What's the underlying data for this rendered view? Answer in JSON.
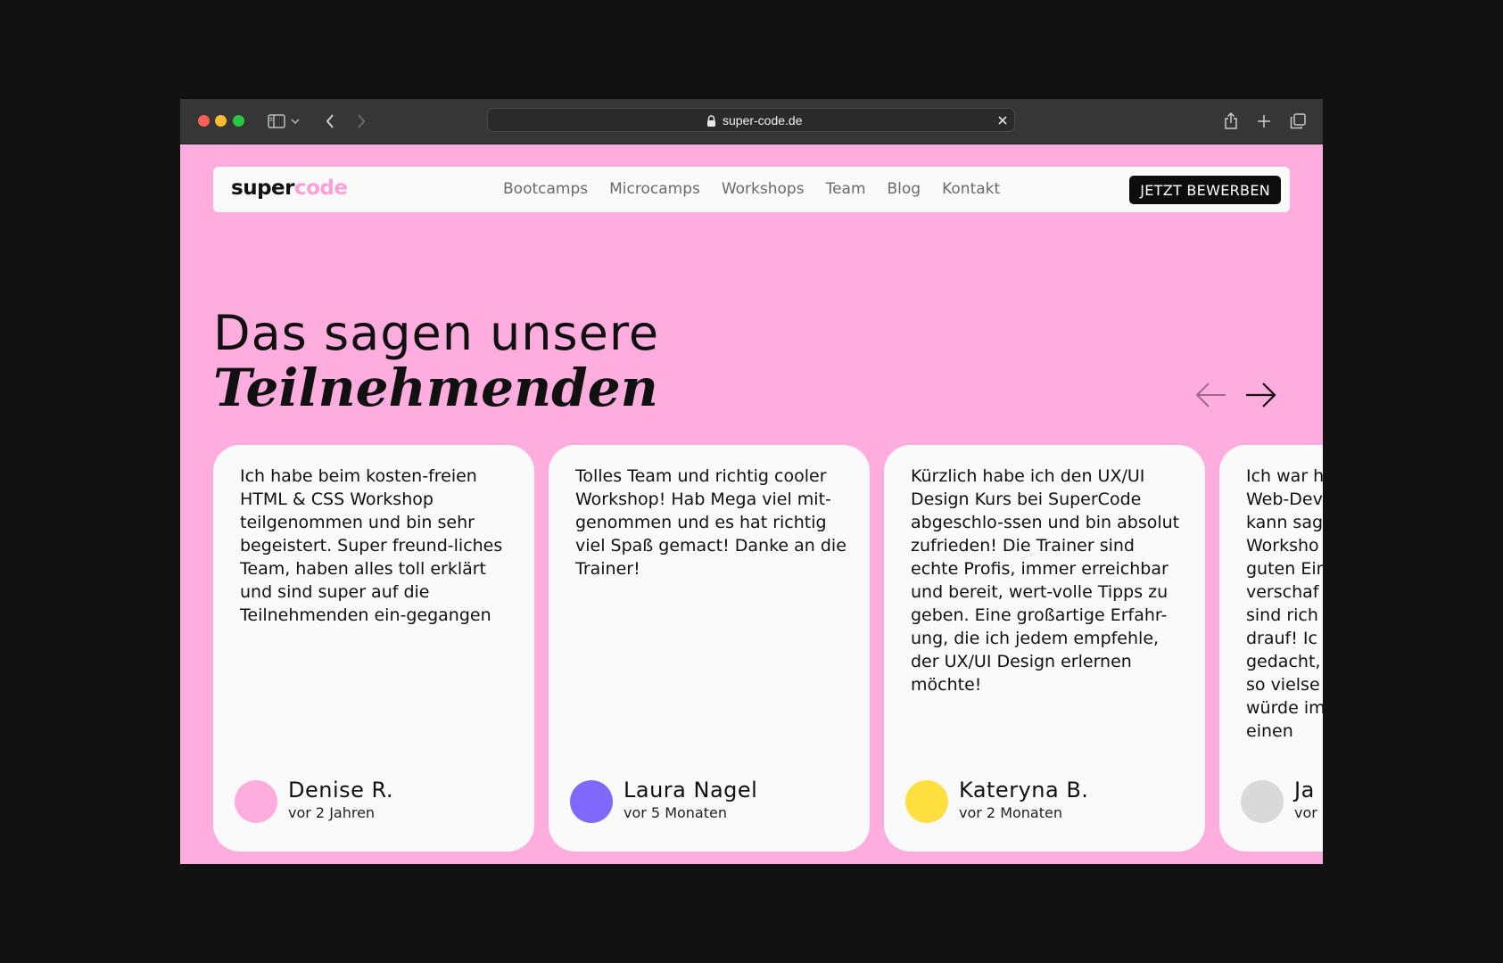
{
  "browser": {
    "url": "super-code.de",
    "traffic_light_colors": [
      "#fe5f57",
      "#febc2e",
      "#28c840"
    ]
  },
  "nav": {
    "logo_part1": "super",
    "logo_part2": "code",
    "links": [
      "Bootcamps",
      "Microcamps",
      "Workshops",
      "Team",
      "Blog",
      "Kontakt"
    ],
    "cta": "JETZT BEWERBEN"
  },
  "section": {
    "title_line1": "Das sagen unsere",
    "title_line2": "Teilnehmenden"
  },
  "testimonials": [
    {
      "quote": "Ich habe beim kosten-freien HTML & CSS Workshop teilgenommen und bin sehr begeistert. Super freund-liches Team, haben alles toll erklärt und sind super auf die Teilnehmenden ein-gegangen",
      "name": "Denise R.",
      "time": "vor 2 Jahren",
      "avatar_color": "#ffadde"
    },
    {
      "quote": "Tolles Team und richtig cooler Workshop! Hab Mega viel mit-genommen und es hat richtig viel Spaß gemact! Danke an die Trainer!",
      "name": "Laura Nagel",
      "time": "vor 5 Monaten",
      "avatar_color": "#7f68fb"
    },
    {
      "quote": "Kürzlich habe ich den UX/UI Design Kurs bei SuperCode abgeschlo-ssen und bin absolut zufrieden! Die Trainer sind echte Profis, immer erreichbar und bereit, wert-volle Tipps zu geben. Eine großartige Erfahr-ung, die ich jedem empfehle, der UX/UI Design erlernen möchte!",
      "name": "Kateryna B.",
      "time": "vor 2 Monaten",
      "avatar_color": "#ffe03f"
    },
    {
      "quote": "Ich war h Web-Dev kann sag Worksho guten Ein verschaf sind rich drauf! Ic gedacht, so vielse würde im einen",
      "name": "Ja",
      "time": "vor",
      "avatar_color": "#d9d9d9"
    }
  ]
}
